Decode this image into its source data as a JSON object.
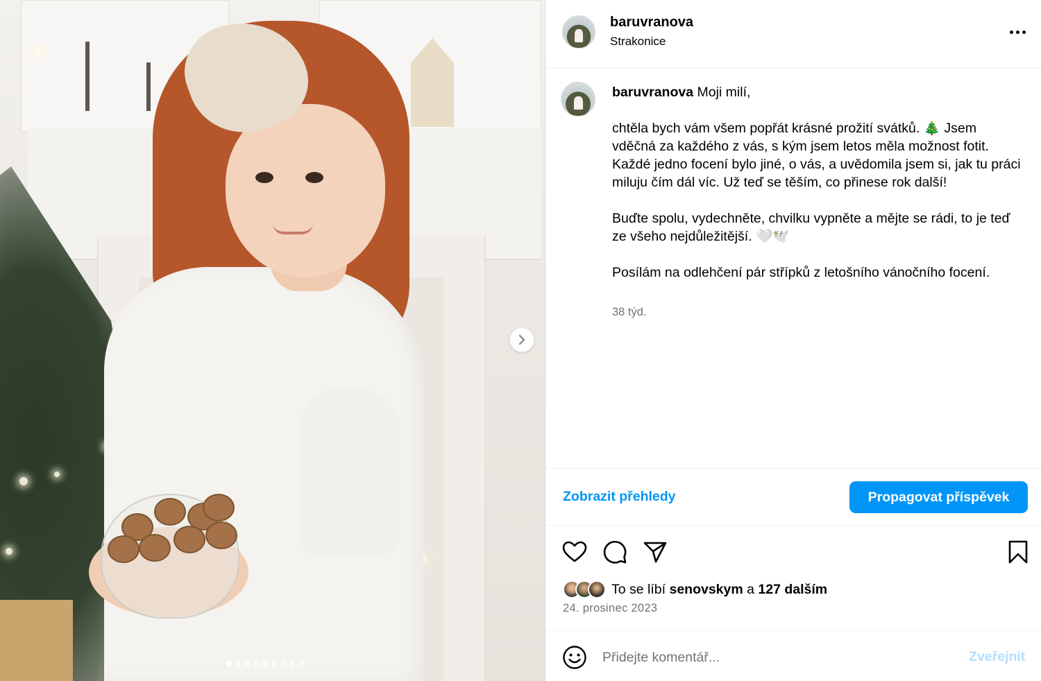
{
  "post": {
    "username": "baruvranova",
    "location": "Strakonice",
    "caption_lines": {
      "l1": "Moji milí,",
      "l2": "chtěla bych vám všem popřát krásné prožití svátků. 🎄 Jsem vděčná za každého z vás, s kým jsem letos měla možnost fotit. Každé jedno focení bylo jiné, o vás, a uvědomila jsem si, jak tu práci miluju čím dál víc. Už teď se těším, co přinese rok další!",
      "l3": "Buďte spolu, vydechněte, chvilku vypněte a mějte se rádi, to je teď ze všeho nejdůležitější. 🤍🕊️",
      "l4": "Posílám na odlehčení pár střípků z letošního vánočního focení."
    },
    "age": "38 týd.",
    "date": "24. prosinec 2023"
  },
  "promo": {
    "insights_label": "Zobrazit přehledy",
    "boost_label": "Propagovat příspěvek"
  },
  "likes": {
    "prefix": "To se líbí ",
    "user": "senovskym",
    "middle": " a ",
    "count_label": "127 dalším"
  },
  "comment": {
    "placeholder": "Přidejte komentář...",
    "post_label": "Zveřejnit"
  },
  "carousel": {
    "total": 9,
    "current": 1
  },
  "icons": {
    "more": "more-options-icon",
    "like": "heart-icon",
    "comment": "comment-icon",
    "share": "share-icon",
    "save": "bookmark-icon",
    "emoji": "emoji-icon",
    "next": "chevron-right-icon"
  },
  "colors": {
    "accent": "#0095f6",
    "muted": "#737373",
    "disabled_accent": "#b2dffc"
  }
}
